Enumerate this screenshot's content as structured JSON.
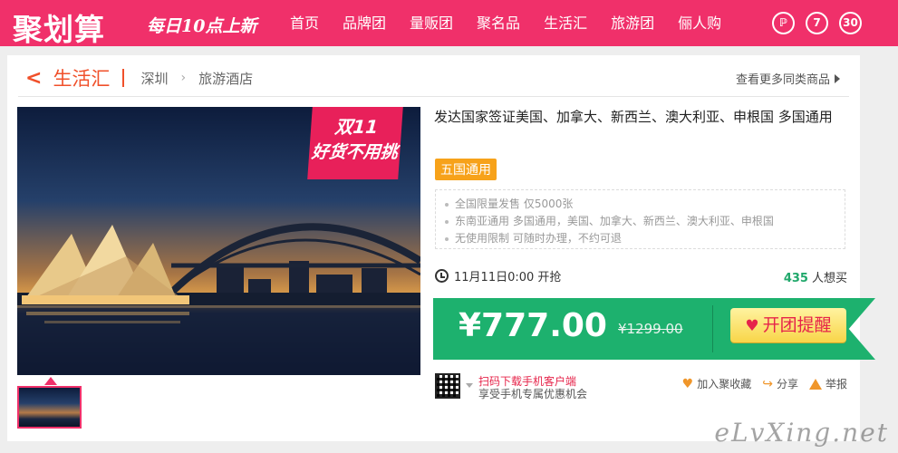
{
  "header": {
    "logo": "聚划算",
    "slogan": "每日10点上新",
    "nav": [
      "首页",
      "品牌团",
      "量贩团",
      "聚名品",
      "生活汇",
      "旅游团",
      "俪人购"
    ],
    "icon_labels": [
      "ℙ",
      "7",
      "30"
    ]
  },
  "breadcrumb": {
    "category": "生活汇",
    "city": "深圳",
    "subcategory": "旅游酒店",
    "more_link": "查看更多同类商品"
  },
  "product": {
    "image_badge_line1": "双11",
    "image_badge_line2": "好货不用挑",
    "title": "发达国家签证美国、加拿大、新西兰、澳大利亚、申根国 多国通用",
    "tag": "五国通用",
    "features": [
      "全国限量发售 仅5000张",
      "东南亚通用 多国通用，美国、加拿大、新西兰、澳大利亚、申根国",
      "无使用限制 可随时办理，不约可退"
    ],
    "start_time": "11月11日0:00 开抢",
    "want_count": "435",
    "want_label": "人想买",
    "price": "¥777.00",
    "original_price": "¥1299.00",
    "cta": "开团提醒"
  },
  "mobile": {
    "line1": "扫码下载手机客户端",
    "line2": "享受手机专属优惠机会"
  },
  "actions": {
    "favorite": "加入聚收藏",
    "share": "分享",
    "report": "举报"
  },
  "watermark": "eLvXing.net",
  "colors": {
    "brand": "#f0306a",
    "price_green": "#1db16e",
    "accent_orange": "#f0502a"
  }
}
